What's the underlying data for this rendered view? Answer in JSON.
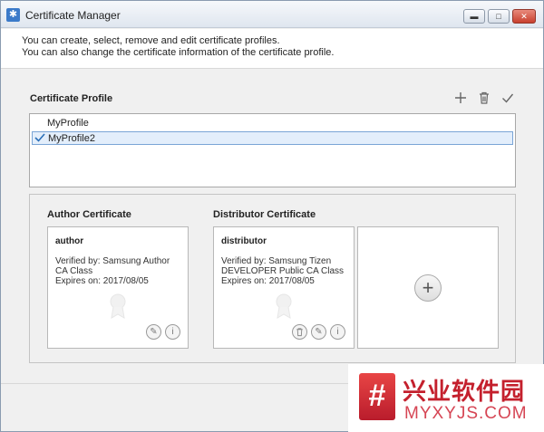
{
  "window": {
    "title": "Certificate Manager",
    "controls": {
      "minimize": "▬",
      "maximize": "□",
      "close": "✕"
    }
  },
  "intro": {
    "line1": "You can create, select, remove and edit certificate profiles.",
    "line2": "You can also change the certificate information of the certificate profile."
  },
  "profile_section": {
    "title": "Certificate Profile",
    "toolbar_icons": [
      "plus-icon",
      "trash-icon",
      "check-icon"
    ],
    "profiles": [
      {
        "name": "MyProfile",
        "selected": false
      },
      {
        "name": "MyProfile2",
        "selected": true
      }
    ]
  },
  "author": {
    "section_title": "Author Certificate",
    "name": "author",
    "verified_line1": "Verified by: Samsung Author",
    "verified_line2": "CA Class",
    "expires": "Expires on: 2017/08/05"
  },
  "distributor": {
    "section_title": "Distributor Certificate",
    "name": "distributor",
    "verified_line1": "Verified by: Samsung Tizen",
    "verified_line2": "DEVELOPER Public CA Class",
    "expires": "Expires on: 2017/08/05"
  },
  "watermark": {
    "glyph": "#",
    "chinese": "兴业软件园",
    "latin": "MYXYJS.COM"
  },
  "colors": {
    "selection_bg": "#e3eefb",
    "selection_border": "#7aa5d6",
    "check": "#2a6fb8",
    "watermark_red": "#c4202d"
  }
}
